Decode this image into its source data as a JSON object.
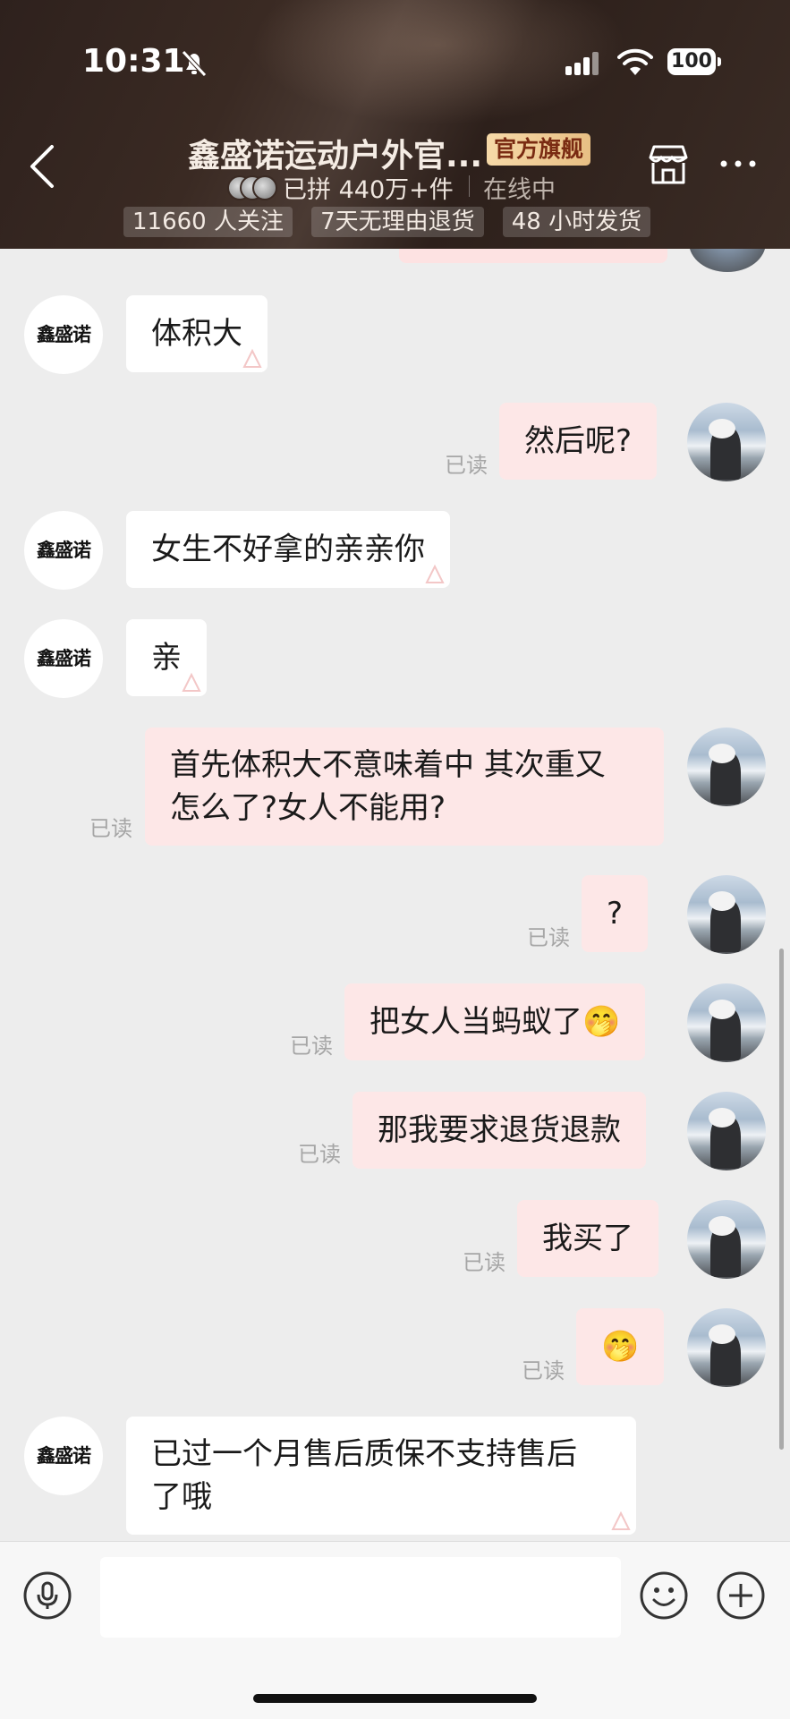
{
  "status_bar": {
    "time": "10:31",
    "battery": "100"
  },
  "header": {
    "shop_name": "鑫盛诺运动户外官...",
    "badge": "官方旗舰",
    "sales": "已拼 440万+件",
    "online_status": "在线中",
    "tags": [
      "11660 人关注",
      "7天无理由退货",
      "48 小时发货"
    ]
  },
  "shop_avatar_label": "鑫盛诺",
  "read_label": "已读",
  "messages": [
    {
      "from": "shop",
      "text": "体积大"
    },
    {
      "from": "user",
      "text": "然后呢?"
    },
    {
      "from": "shop",
      "text": "女生不好拿的亲亲你"
    },
    {
      "from": "shop",
      "text": "亲"
    },
    {
      "from": "user",
      "lines": [
        "首先体积大不意味着中 其次重又",
        "怎么了?女人不能用?"
      ]
    },
    {
      "from": "user",
      "text": "?"
    },
    {
      "from": "user",
      "text": "把女人当蚂蚁了🤭"
    },
    {
      "from": "user",
      "text": "那我要求退货退款"
    },
    {
      "from": "user",
      "text": "我买了"
    },
    {
      "from": "user",
      "text": "🤭"
    },
    {
      "from": "shop",
      "lines": [
        "已过一个月售后质保不支持售后",
        "了哦"
      ]
    }
  ],
  "input": {
    "placeholder": ""
  },
  "icons": {
    "back": "chevron-left-icon",
    "store": "store-icon",
    "more": "more-icon",
    "mic": "microphone-icon",
    "emoji": "emoji-icon",
    "plus": "plus-icon"
  }
}
